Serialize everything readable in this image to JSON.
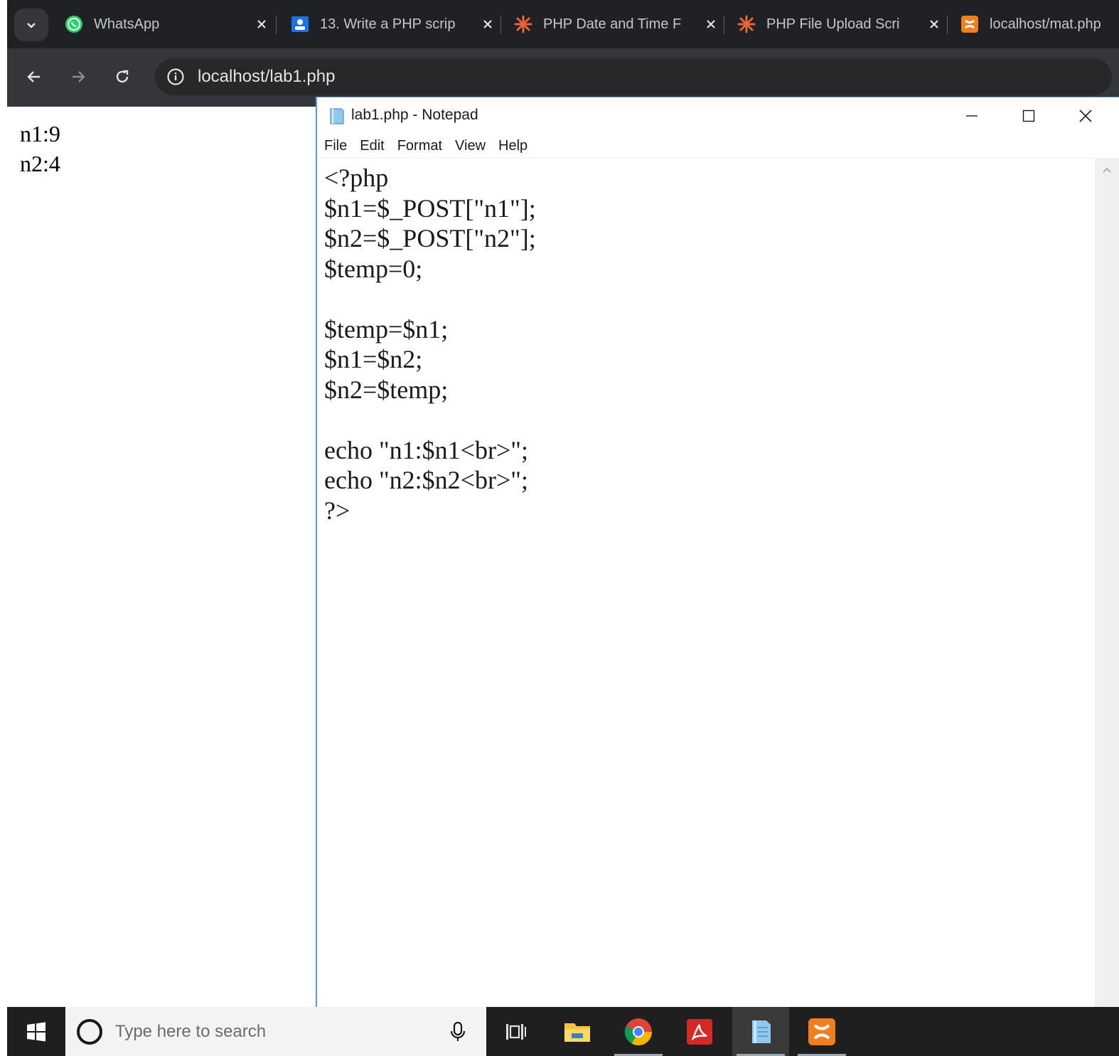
{
  "browser": {
    "tabs": [
      {
        "title": "WhatsApp",
        "icon": "whatsapp-icon"
      },
      {
        "title": "13. Write a PHP scrip",
        "icon": "classroom-icon"
      },
      {
        "title": "PHP Date and Time F",
        "icon": "php-burst-icon"
      },
      {
        "title": "PHP File Upload Scri",
        "icon": "php-burst-icon"
      },
      {
        "title": "localhost/mat.php",
        "icon": "xampp-icon"
      }
    ],
    "address": "localhost/lab1.php"
  },
  "page_output": [
    "n1:9",
    "n2:4"
  ],
  "notepad": {
    "title": "lab1.php - Notepad",
    "menu": [
      "File",
      "Edit",
      "Format",
      "View",
      "Help"
    ],
    "code": "<?php\n$n1=$_POST[\"n1\"];\n$n2=$_POST[\"n2\"];\n$temp=0;\n\n$temp=$n1;\n$n1=$n2;\n$n2=$temp;\n\necho \"n1:$n1<br>\";\necho \"n2:$n2<br>\";\n?>"
  },
  "taskbar": {
    "search_placeholder": "Type here to search",
    "apps": [
      "task-view-icon",
      "file-explorer-icon",
      "chrome-icon",
      "acrobat-icon",
      "notepad-icon",
      "xampp-icon"
    ]
  },
  "colors": {
    "tab_strip": "#202124",
    "toolbar": "#35363a",
    "notepad_border": "#5b9bd5",
    "whatsapp": "#25d366",
    "php_burst": "#e8653a",
    "xampp": "#f07f20"
  }
}
